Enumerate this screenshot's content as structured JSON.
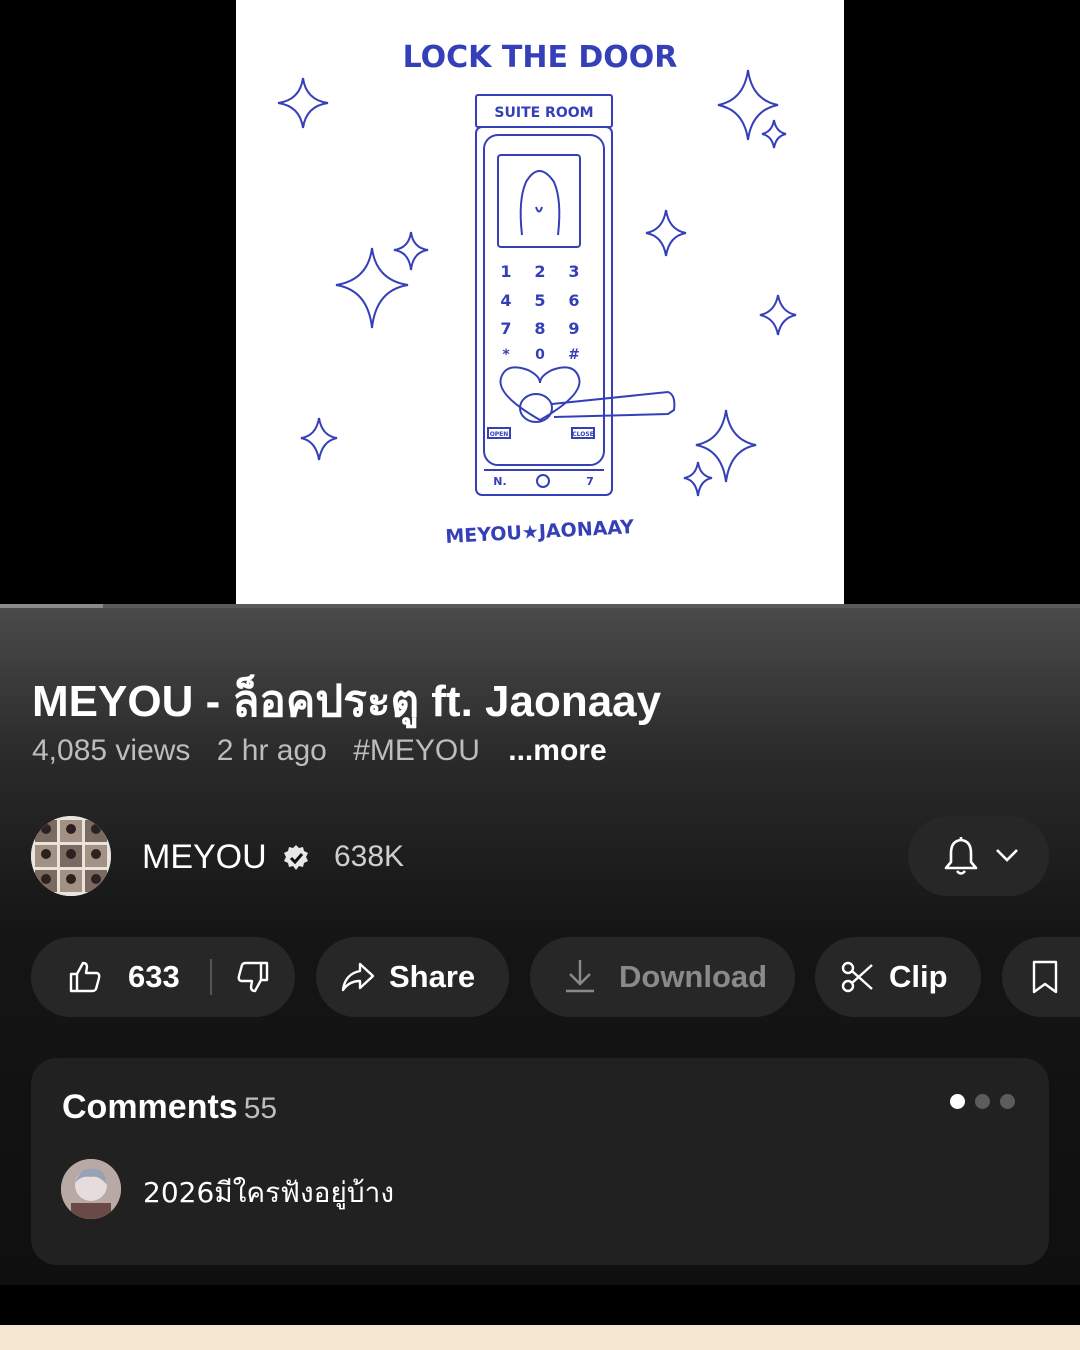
{
  "artwork": {
    "heading": "LOCK THE DOOR",
    "sign": "SUITE ROOM",
    "keypad": [
      "1",
      "2",
      "3",
      "4",
      "5",
      "6",
      "7",
      "8",
      "9",
      "*",
      "0",
      "#"
    ],
    "open_label": "OPEN",
    "close_label": "CLOSE",
    "plate_left": "N.",
    "plate_right": "7",
    "artists": "MEYOU★JAONAAY"
  },
  "player": {
    "progress_fraction": 0.095
  },
  "video": {
    "title": "MEYOU - ล็อคประตู ft. Jaonaay",
    "views": "4,085 views",
    "age": "2 hr ago",
    "hashtag": "#MEYOU",
    "more": "...more"
  },
  "channel": {
    "name": "MEYOU",
    "verified": true,
    "subscribers": "638K"
  },
  "actions": {
    "likes": "633",
    "share": "Share",
    "download": "Download",
    "clip": "Clip"
  },
  "comments": {
    "heading": "Comments",
    "count": "55",
    "top_comment": "2026มีใครฟังอยู่บ้าง"
  },
  "icons": [
    "like-icon",
    "dislike-icon",
    "share-icon",
    "download-icon",
    "clip-icon",
    "save-icon",
    "bell-icon",
    "chevron-down-icon",
    "verified-icon"
  ]
}
